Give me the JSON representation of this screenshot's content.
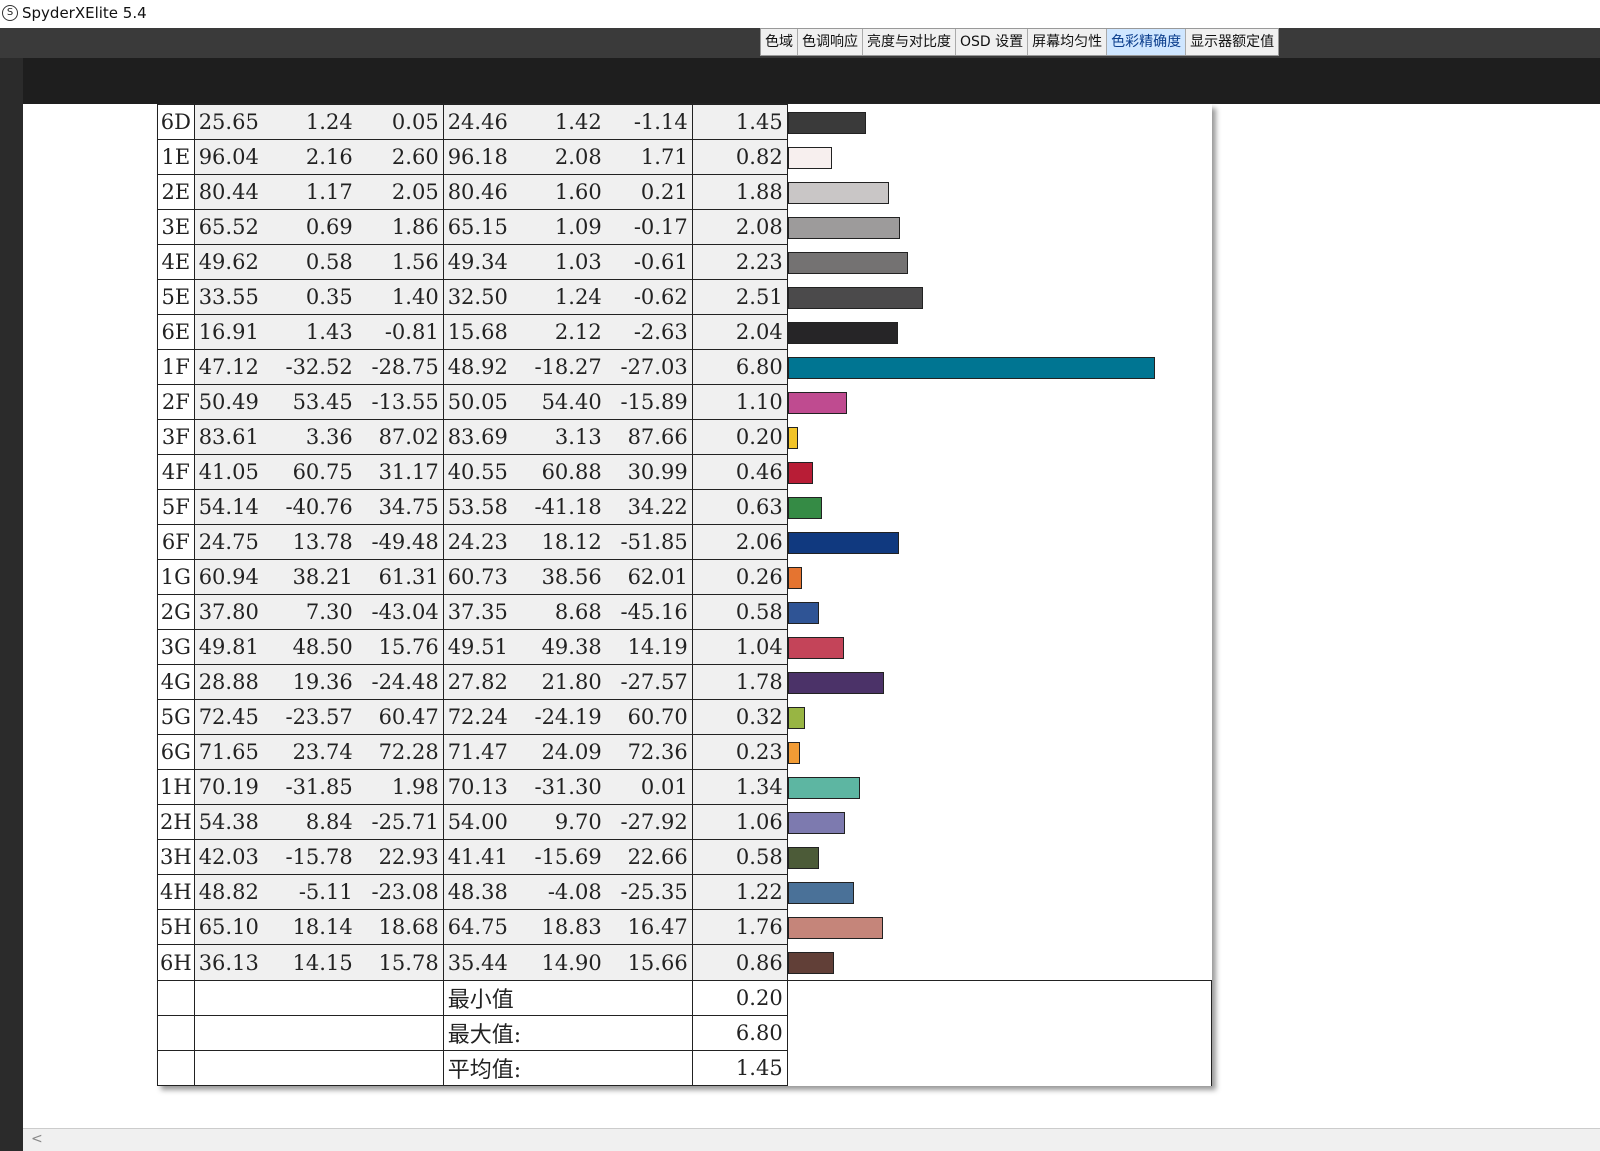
{
  "window": {
    "title": "SpyderXElite 5.4",
    "icon": "S"
  },
  "tabs": [
    {
      "label": "色域",
      "active": false
    },
    {
      "label": "色调响应",
      "active": false
    },
    {
      "label": "亮度与对比度",
      "active": false
    },
    {
      "label": "OSD 设置",
      "active": false
    },
    {
      "label": "屏幕均匀性",
      "active": false
    },
    {
      "label": "色彩精确度",
      "active": true
    },
    {
      "label": "显示器额定值",
      "active": false
    }
  ],
  "rows": [
    {
      "id": "6D",
      "ref": [
        "25.65",
        "1.24",
        "0.05"
      ],
      "meas": [
        "24.46",
        "1.42",
        "-1.14"
      ],
      "de": "1.45",
      "color": "#3a3a3a"
    },
    {
      "id": "1E",
      "ref": [
        "96.04",
        "2.16",
        "2.60"
      ],
      "meas": [
        "96.18",
        "2.08",
        "1.71"
      ],
      "de": "0.82",
      "color": "#f7efee"
    },
    {
      "id": "2E",
      "ref": [
        "80.44",
        "1.17",
        "2.05"
      ],
      "meas": [
        "80.46",
        "1.60",
        "0.21"
      ],
      "de": "1.88",
      "color": "#c9c6c6"
    },
    {
      "id": "3E",
      "ref": [
        "65.52",
        "0.69",
        "1.86"
      ],
      "meas": [
        "65.15",
        "1.09",
        "-0.17"
      ],
      "de": "2.08",
      "color": "#9d9b9b"
    },
    {
      "id": "4E",
      "ref": [
        "49.62",
        "0.58",
        "1.56"
      ],
      "meas": [
        "49.34",
        "1.03",
        "-0.61"
      ],
      "de": "2.23",
      "color": "#747272"
    },
    {
      "id": "5E",
      "ref": [
        "33.55",
        "0.35",
        "1.40"
      ],
      "meas": [
        "32.50",
        "1.24",
        "-0.62"
      ],
      "de": "2.51",
      "color": "#4b4a4b"
    },
    {
      "id": "6E",
      "ref": [
        "16.91",
        "1.43",
        "-0.81"
      ],
      "meas": [
        "15.68",
        "2.12",
        "-2.63"
      ],
      "de": "2.04",
      "color": "#262527"
    },
    {
      "id": "1F",
      "ref": [
        "47.12",
        "-32.52",
        "-28.75"
      ],
      "meas": [
        "48.92",
        "-18.27",
        "-27.03"
      ],
      "de": "6.80",
      "color": "#007592"
    },
    {
      "id": "2F",
      "ref": [
        "50.49",
        "53.45",
        "-13.55"
      ],
      "meas": [
        "50.05",
        "54.40",
        "-15.89"
      ],
      "de": "1.10",
      "color": "#bf4b90"
    },
    {
      "id": "3F",
      "ref": [
        "83.61",
        "3.36",
        "87.02"
      ],
      "meas": [
        "83.69",
        "3.13",
        "87.66"
      ],
      "de": "0.20",
      "color": "#f2c428"
    },
    {
      "id": "4F",
      "ref": [
        "41.05",
        "60.75",
        "31.17"
      ],
      "meas": [
        "40.55",
        "60.88",
        "30.99"
      ],
      "de": "0.46",
      "color": "#b81d36"
    },
    {
      "id": "5F",
      "ref": [
        "54.14",
        "-40.76",
        "34.75"
      ],
      "meas": [
        "53.58",
        "-41.18",
        "34.22"
      ],
      "de": "0.63",
      "color": "#358b45"
    },
    {
      "id": "6F",
      "ref": [
        "24.75",
        "13.78",
        "-49.48"
      ],
      "meas": [
        "24.23",
        "18.12",
        "-51.85"
      ],
      "de": "2.06",
      "color": "#10397f"
    },
    {
      "id": "1G",
      "ref": [
        "60.94",
        "38.21",
        "61.31"
      ],
      "meas": [
        "60.73",
        "38.56",
        "62.01"
      ],
      "de": "0.26",
      "color": "#e57430"
    },
    {
      "id": "2G",
      "ref": [
        "37.80",
        "7.30",
        "-43.04"
      ],
      "meas": [
        "37.35",
        "8.68",
        "-45.16"
      ],
      "de": "0.58",
      "color": "#2f5495"
    },
    {
      "id": "3G",
      "ref": [
        "49.81",
        "48.50",
        "15.76"
      ],
      "meas": [
        "49.51",
        "49.38",
        "14.19"
      ],
      "de": "1.04",
      "color": "#c44459"
    },
    {
      "id": "4G",
      "ref": [
        "28.88",
        "19.36",
        "-24.48"
      ],
      "meas": [
        "27.82",
        "21.80",
        "-27.57"
      ],
      "de": "1.78",
      "color": "#4b3268"
    },
    {
      "id": "5G",
      "ref": [
        "72.45",
        "-23.57",
        "60.47"
      ],
      "meas": [
        "72.24",
        "-24.19",
        "60.70"
      ],
      "de": "0.32",
      "color": "#98b543"
    },
    {
      "id": "6G",
      "ref": [
        "71.65",
        "23.74",
        "72.28"
      ],
      "meas": [
        "71.47",
        "24.09",
        "72.36"
      ],
      "de": "0.23",
      "color": "#f19b35"
    },
    {
      "id": "1H",
      "ref": [
        "70.19",
        "-31.85",
        "1.98"
      ],
      "meas": [
        "70.13",
        "-31.30",
        "0.01"
      ],
      "de": "1.34",
      "color": "#5db6a2"
    },
    {
      "id": "2H",
      "ref": [
        "54.38",
        "8.84",
        "-25.71"
      ],
      "meas": [
        "54.00",
        "9.70",
        "-27.92"
      ],
      "de": "1.06",
      "color": "#7d7aaf"
    },
    {
      "id": "3H",
      "ref": [
        "42.03",
        "-15.78",
        "22.93"
      ],
      "meas": [
        "41.41",
        "-15.69",
        "22.66"
      ],
      "de": "0.58",
      "color": "#4c5b38"
    },
    {
      "id": "4H",
      "ref": [
        "48.82",
        "-5.11",
        "-23.08"
      ],
      "meas": [
        "48.38",
        "-4.08",
        "-25.35"
      ],
      "de": "1.22",
      "color": "#4a7198"
    },
    {
      "id": "5H",
      "ref": [
        "65.10",
        "18.14",
        "18.68"
      ],
      "meas": [
        "64.75",
        "18.83",
        "16.47"
      ],
      "de": "1.76",
      "color": "#c5857a"
    },
    {
      "id": "6H",
      "ref": [
        "36.13",
        "14.15",
        "15.78"
      ],
      "meas": [
        "35.44",
        "14.90",
        "15.66"
      ],
      "de": "0.86",
      "color": "#613f37"
    }
  ],
  "summary": [
    {
      "label": "最小值",
      "value": "0.20"
    },
    {
      "label": "最大值:",
      "value": "6.80"
    },
    {
      "label": "平均值:",
      "value": "1.45"
    }
  ],
  "chart_data": {
    "type": "bar",
    "orientation": "horizontal",
    "categories": [
      "6D",
      "1E",
      "2E",
      "3E",
      "4E",
      "5E",
      "6E",
      "1F",
      "2F",
      "3F",
      "4F",
      "5F",
      "6F",
      "1G",
      "2G",
      "3G",
      "4G",
      "5G",
      "6G",
      "1H",
      "2H",
      "3H",
      "4H",
      "5H",
      "6H"
    ],
    "values": [
      1.45,
      0.82,
      1.88,
      2.08,
      2.23,
      2.51,
      2.04,
      6.8,
      1.1,
      0.2,
      0.46,
      0.63,
      2.06,
      0.26,
      0.58,
      1.04,
      1.78,
      0.32,
      0.23,
      1.34,
      1.06,
      0.58,
      1.22,
      1.76,
      0.86
    ],
    "xlim": [
      0,
      8
    ],
    "grid": true
  }
}
